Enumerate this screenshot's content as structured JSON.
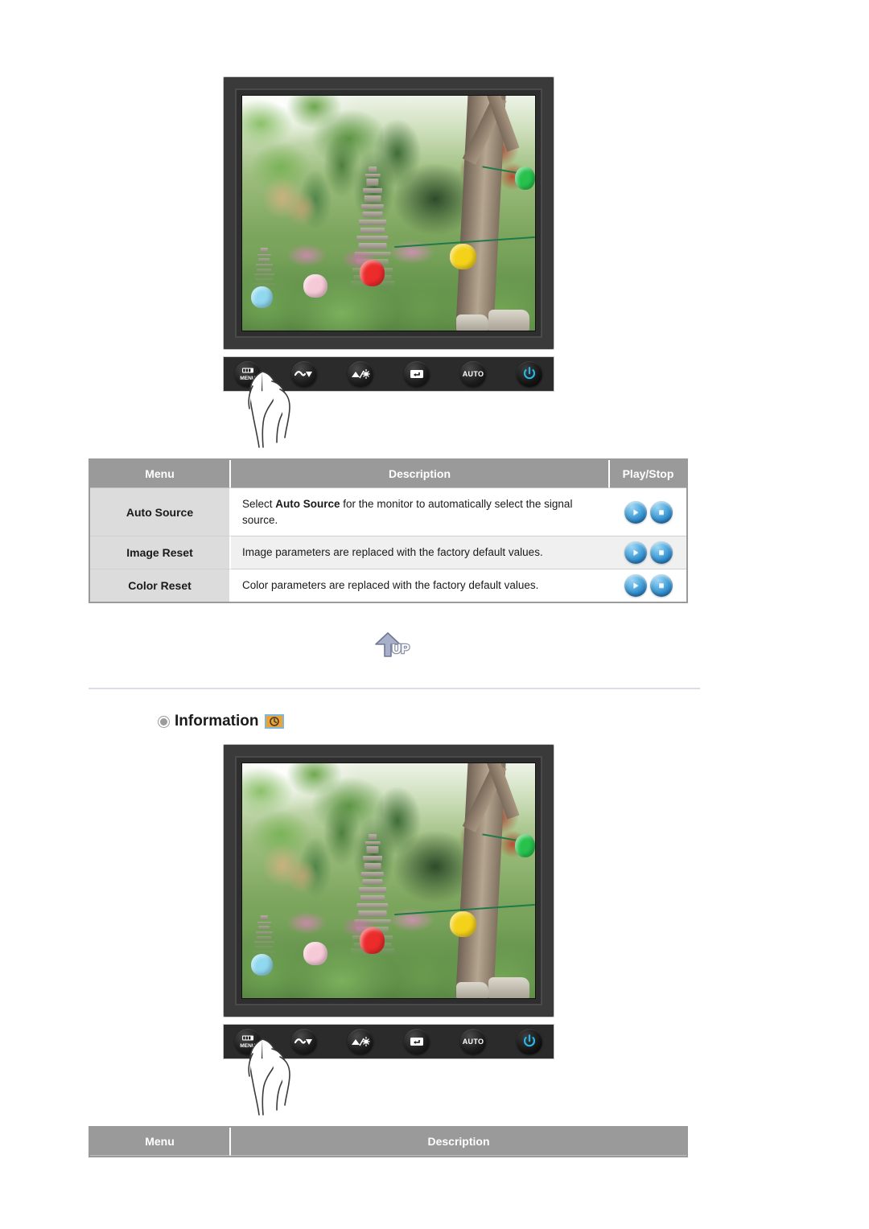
{
  "monitor_top": {
    "alt": "LCD monitor front view showing garden photo on screen",
    "photo_caption": "Korean garden with stone pagoda, trees and paper lanterns",
    "controls": [
      {
        "name": "menu-button",
        "label": "MENU",
        "icon": "menu-icon"
      },
      {
        "name": "down-button",
        "label": "",
        "icon": "down-arrow-icon"
      },
      {
        "name": "brightness-button",
        "label": "",
        "icon": "brightness-icon"
      },
      {
        "name": "enter-button",
        "label": "",
        "icon": "enter-icon"
      },
      {
        "name": "auto-button",
        "label": "AUTO",
        "icon": "auto-icon"
      },
      {
        "name": "power-button",
        "label": "",
        "icon": "power-icon"
      }
    ],
    "hand": "hand-pressing-menu"
  },
  "table_reset": {
    "headers": [
      "Menu",
      "Description",
      "Play/Stop"
    ],
    "rows": [
      {
        "menu": "Auto Source",
        "desc_pre": "Select ",
        "desc_emph": "Auto Source",
        "desc_post": " for the monitor to automatically select the signal source.",
        "play": "play-icon",
        "stop": "stop-icon"
      },
      {
        "menu": "Image Reset",
        "desc_pre": "Image parameters are replaced with the factory default values.",
        "desc_emph": "",
        "desc_post": "",
        "play": "play-icon",
        "stop": "stop-icon"
      },
      {
        "menu": "Color Reset",
        "desc_pre": "Color parameters are replaced with the factory default values.",
        "desc_emph": "",
        "desc_post": "",
        "play": "play-icon",
        "stop": "stop-icon"
      }
    ]
  },
  "up_button": {
    "label": "UP",
    "icon": "up-arrow-icon"
  },
  "section_information": {
    "title": "Information",
    "bullet_icon": "bullet-icon",
    "badge_icon": "info-clock-icon"
  },
  "monitor_bottom": {
    "alt": "LCD monitor front view showing garden photo on screen",
    "photo_caption": "Korean garden with stone pagoda, trees and paper lanterns",
    "controls": [
      {
        "name": "menu-button",
        "label": "MENU",
        "icon": "menu-icon"
      },
      {
        "name": "down-button",
        "label": "",
        "icon": "down-arrow-icon"
      },
      {
        "name": "brightness-button",
        "label": "",
        "icon": "brightness-icon"
      },
      {
        "name": "enter-button",
        "label": "",
        "icon": "enter-icon"
      },
      {
        "name": "auto-button",
        "label": "AUTO",
        "icon": "auto-icon"
      },
      {
        "name": "power-button",
        "label": "",
        "icon": "power-icon"
      }
    ],
    "hand": "hand-pressing-menu"
  },
  "table_information": {
    "headers": [
      "Menu",
      "Description"
    ]
  },
  "colors": {
    "header_gray": "#9a9a9a",
    "menu_cell_gray": "#dcdcdc",
    "alt_row": "#f0f0f0",
    "bezel": "#3a3a3a",
    "power_blue": "#23b7e8",
    "badge_orange": "#f0a22e",
    "badge_border_blue": "#7fb6dd",
    "divider": "#dcdce6",
    "play_blue": "#1d74b8"
  }
}
